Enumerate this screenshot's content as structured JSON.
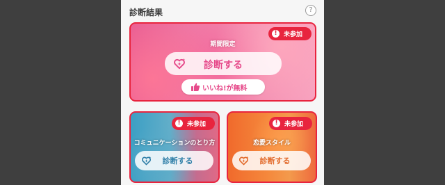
{
  "header": {
    "title": "診断結果",
    "help_symbol": "?"
  },
  "status": {
    "not_participated": "未参加",
    "alert_symbol": "!"
  },
  "featured": {
    "label": "期間限定",
    "button_label": "診断する",
    "like_label": "いいね!が無料"
  },
  "cards": [
    {
      "label": "コミュニケーションのとり方",
      "button_label": "診断する"
    },
    {
      "label": "恋愛スタイル",
      "button_label": "診断する"
    }
  ],
  "colors": {
    "accent_red": "#e8243e",
    "pink_text": "#e64a8a",
    "blue_text": "#2f7fa8",
    "orange_text": "#e26a2a"
  }
}
